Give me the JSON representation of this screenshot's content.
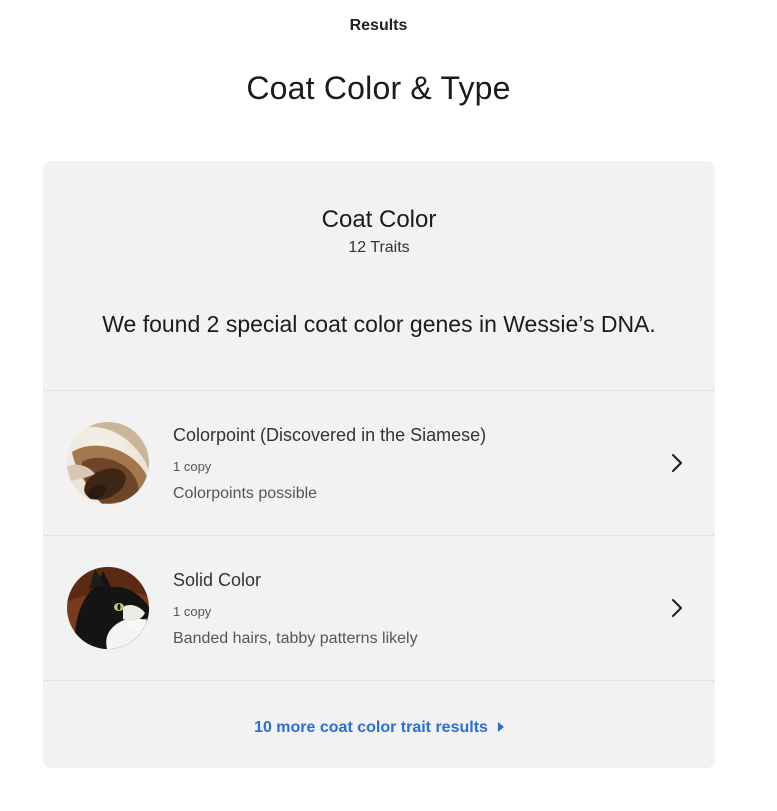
{
  "header": {
    "tab_label": "Results",
    "page_title": "Coat Color & Type"
  },
  "card": {
    "section_title": "Coat Color",
    "trait_count": "12 Traits",
    "summary": "We found 2 special coat color genes in Wessie’s DNA.",
    "traits": [
      {
        "name": "Colorpoint (Discovered in the Siamese)",
        "copies": "1 copy",
        "description": "Colorpoints possible",
        "image": "siamese-paw-photo"
      },
      {
        "name": "Solid Color",
        "copies": "1 copy",
        "description": "Banded hairs, tabby patterns likely",
        "image": "tuxedo-cat-photo"
      }
    ],
    "more_link": "10 more coat color trait results"
  },
  "colors": {
    "card_background": "#f2f2f2",
    "link": "#2b6fd6",
    "text": "#1b1b1b"
  },
  "icons": {
    "row_chevron": "chevron-right-icon",
    "link_caret": "caret-right-icon"
  }
}
